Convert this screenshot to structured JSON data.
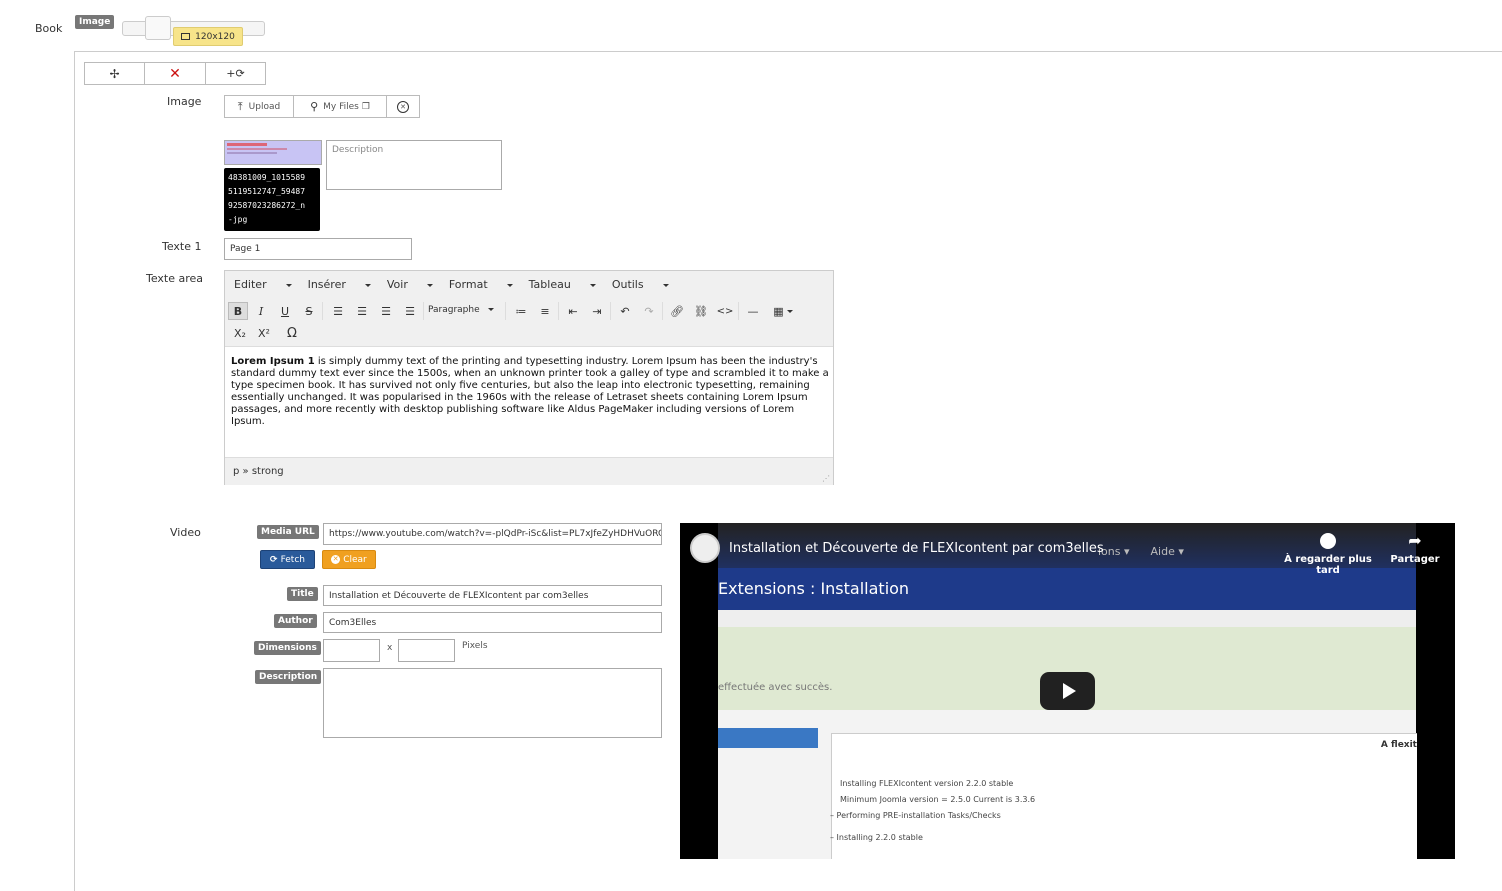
{
  "book": {
    "label": "Book",
    "badge": "Image",
    "size_tooltip": "120x120",
    "size_icon": "image-icon"
  },
  "controls": {
    "move_icon": "move-icon",
    "delete_icon": "close-icon",
    "add_icon": "add-copy-icon",
    "accent_red": "#cc1111"
  },
  "image": {
    "label": "Image",
    "upload_label": "Upload",
    "myfiles_label": "My Files",
    "description_placeholder": "Description",
    "filename": "48381009_1015589\n5119512747_59487\n92587023286272_n\n-jpg"
  },
  "texte1": {
    "label": "Texte 1",
    "value": "Page 1"
  },
  "textarea": {
    "label": "Texte area",
    "menu": [
      "Editer",
      "Insérer",
      "Voir",
      "Format",
      "Tableau",
      "Outils"
    ],
    "block_format": "Paragraphe",
    "content_bold": "Lorem Ipsum 1",
    "content_rest": " is simply dummy text of the printing and typesetting industry. Lorem Ipsum has been the industry's standard dummy text ever since the 1500s, when an unknown printer took a galley of type and scrambled it to make a type specimen book. It has survived not only five centuries, but also the leap into electronic typesetting, remaining essentially unchanged. It was popularised in the 1960s with the release of Letraset sheets containing Lorem Ipsum passages, and more recently with desktop publishing software like Aldus PageMaker including versions of Lorem Ipsum.",
    "statusbar": "p » strong"
  },
  "video": {
    "label": "Video",
    "media_url_badge": "Media URL",
    "url": "https://www.youtube.com/watch?v=-plQdPr-iSc&list=PL7xJfeZyHDHVuORCu",
    "fetch_label": "Fetch",
    "clear_label": "Clear",
    "title_badge": "Title",
    "title_value": "Installation et Découverte de FLEXIcontent par com3elles",
    "author_badge": "Author",
    "author_value": "Com3Elles",
    "dimensions_badge": "Dimensions",
    "dimensions_x": "x",
    "dimensions_unit": "Pixels",
    "description_badge": "Description",
    "fetch_color": "#2a5a9a",
    "clear_color": "#f0a020"
  },
  "player": {
    "title": "Installation et Découverte de FLEXIcontent par com3elles",
    "watch_later": "À regarder plus tard",
    "share": "Partager",
    "bg_menu": "ions",
    "bg_menu2": "Aide",
    "bg_heading": "Extensions : Installation",
    "bg_success": "effectuée avec succès.",
    "bg_right": "A flexit",
    "bg_lines": [
      "Installing FLEXIcontent version 2.2.0 stable",
      "Minimum Joomla version = 2.5.0   Current is 3.3.6",
      "– Performing PRE-installation Tasks/Checks",
      "– Installing 2.2.0 stable"
    ]
  }
}
